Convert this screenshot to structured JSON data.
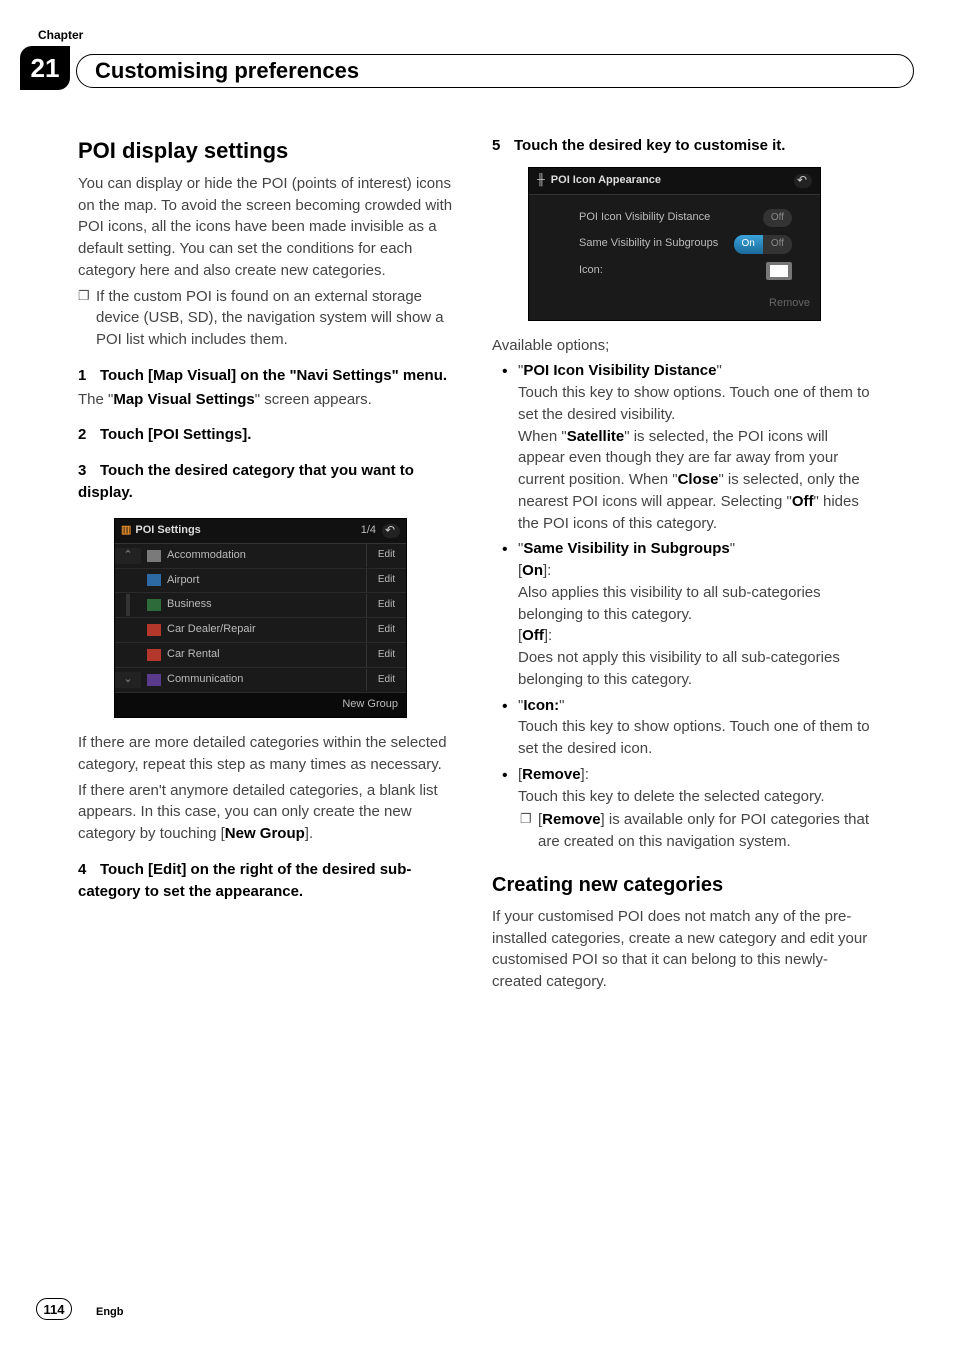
{
  "chapter": {
    "label": "Chapter",
    "number": "21",
    "title": "Customising preferences"
  },
  "left": {
    "h2": "POI display settings",
    "intro": "You can display or hide the POI (points of interest) icons on the map. To avoid the screen becoming crowded with POI icons, all the icons have been made invisible as a default setting. You can set the conditions for each category here and also create new categories.",
    "note": "If the custom POI is found on an external storage device (USB, SD), the navigation system will show a POI list which includes them.",
    "step1a": "Touch [Map Visual] on the \"Navi Settings\" menu.",
    "step1b_pre": "The \"",
    "step1b_bold": "Map Visual Settings",
    "step1b_post": "\" screen appears.",
    "step2": "Touch [POI Settings].",
    "step3": "Touch the desired category that you want to display.",
    "shot1": {
      "title": "POI Settings",
      "page": "1/4",
      "rows": [
        {
          "label": "Accommodation",
          "edit": "Edit"
        },
        {
          "label": "Airport",
          "edit": "Edit"
        },
        {
          "label": "Business",
          "edit": "Edit"
        },
        {
          "label": "Car Dealer/Repair",
          "edit": "Edit"
        },
        {
          "label": "Car Rental",
          "edit": "Edit"
        },
        {
          "label": "Communication",
          "edit": "Edit"
        }
      ],
      "footer": "New Group"
    },
    "after1": "If there are more detailed categories within the selected category, repeat this step as many times as necessary.",
    "after2_pre": "If there aren't anymore detailed categories, a blank list appears. In this case, you can only create the new category by touching [",
    "after2_bold": "New Group",
    "after2_post": "].",
    "step4": "Touch [Edit] on the right of the desired sub-category to set the appearance."
  },
  "right": {
    "step5": "Touch the desired key to customise it.",
    "shot2": {
      "title": "POI Icon Appearance",
      "row1": "POI Icon Visibility Distance",
      "row1_val": "Off",
      "row2": "Same Visibility in Subgroups",
      "row2_on": "On",
      "row2_off": "Off",
      "row3": "Icon:",
      "footer": "Remove"
    },
    "avail": "Available options;",
    "o1_title": "POI Icon Visibility Distance",
    "o1_a": "Touch this key to show options. Touch one of them to set the desired visibility.",
    "o1_b_pre": "When \"",
    "o1_b_sat": "Satellite",
    "o1_b_mid": "\" is selected, the POI icons will appear even though they are far away from your current position. When \"",
    "o1_b_close": "Close",
    "o1_b_mid2": "\" is selected, only the nearest POI icons will appear. Selecting \"",
    "o1_b_off": "Off",
    "o1_b_post": "\" hides the POI icons of this category.",
    "o2_title": "Same Visibility in Subgroups",
    "o2_on_label": "On",
    "o2_on_text": "Also applies this visibility to all sub-categories belonging to this category.",
    "o2_off_label": "Off",
    "o2_off_text": "Does not apply this visibility to all sub-categories belonging to this category.",
    "o3_title": "Icon:",
    "o3_text": "Touch this key to show options. Touch one of them to set the desired icon.",
    "o4_title": "Remove",
    "o4_text": "Touch this key to delete the selected category.",
    "o4_note_bold": "Remove",
    "o4_note_rest": "] is available only for POI categories that are created on this navigation system.",
    "h2b": "Creating new categories",
    "cn_text": "If your customised POI does not match any of the pre-installed categories, create a new category and edit your customised POI so that it can belong to this newly-created category."
  },
  "footer": {
    "page": "114",
    "lang": "Engb"
  }
}
